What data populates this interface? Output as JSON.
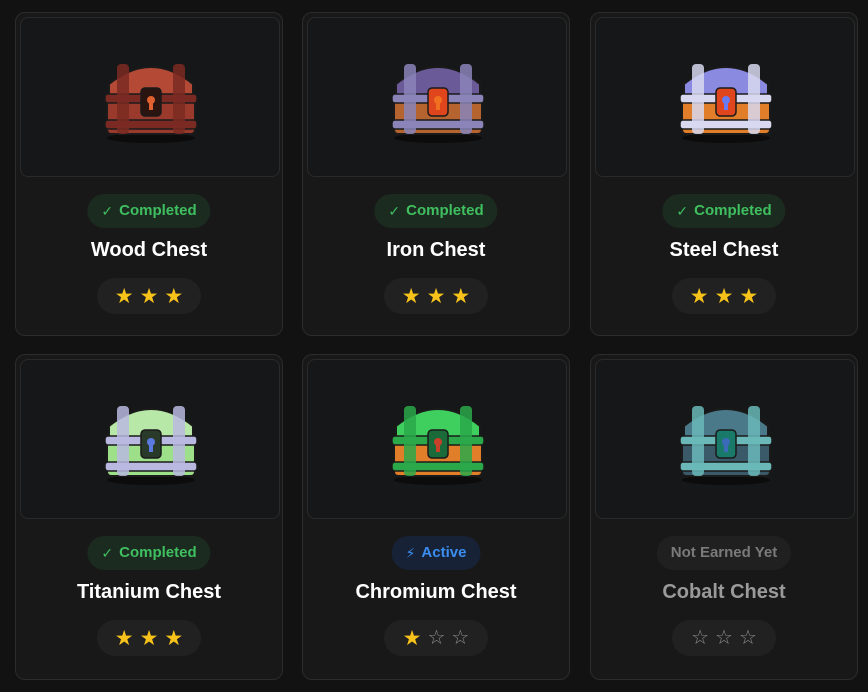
{
  "cards": [
    {
      "name": "Wood Chest",
      "status": "Completed",
      "status_icon": "check-icon",
      "stars_earned": 3,
      "stars_total": 3,
      "colors": {
        "body": "#9a3a2c",
        "lid": "#b44a36",
        "band": "#7a2a22",
        "lock": "#2a1410",
        "accent": "#e06030"
      }
    },
    {
      "name": "Iron Chest",
      "status": "Completed",
      "status_icon": "check-icon",
      "stars_earned": 3,
      "stars_total": 3,
      "colors": {
        "body": "#b5632f",
        "lid": "#6b5a98",
        "band": "#8a84b8",
        "lock": "#e0461e",
        "accent": "#f07020"
      }
    },
    {
      "name": "Steel Chest",
      "status": "Completed",
      "status_icon": "check-icon",
      "stars_earned": 3,
      "stars_total": 3,
      "colors": {
        "body": "#e07e2a",
        "lid": "#8a8ae0",
        "band": "#d8d8f0",
        "lock": "#e0461e",
        "accent": "#6a7af0"
      }
    },
    {
      "name": "Titanium Chest",
      "status": "Completed",
      "status_icon": "check-icon",
      "stars_earned": 3,
      "stars_total": 3,
      "colors": {
        "body": "#9ee08a",
        "lid": "#b8e8a8",
        "band": "#b8b8e0",
        "lock": "#2a3a2a",
        "accent": "#5a7ae0"
      }
    },
    {
      "name": "Chromium Chest",
      "status": "Active",
      "status_icon": "lightning-icon",
      "stars_earned": 1,
      "stars_total": 3,
      "colors": {
        "body": "#e07e2a",
        "lid": "#3fcf5f",
        "band": "#2aa84a",
        "lock": "#1a6a3a",
        "accent": "#c8402a"
      }
    },
    {
      "name": "Cobalt Chest",
      "status": "Not Earned Yet",
      "status_icon": "",
      "stars_earned": 0,
      "stars_total": 3,
      "colors": {
        "body": "#3a5a6a",
        "lid": "#4a7a8a",
        "band": "#6ab8b8",
        "lock": "#1a7a6a",
        "accent": "#3a6ab8"
      }
    }
  ]
}
